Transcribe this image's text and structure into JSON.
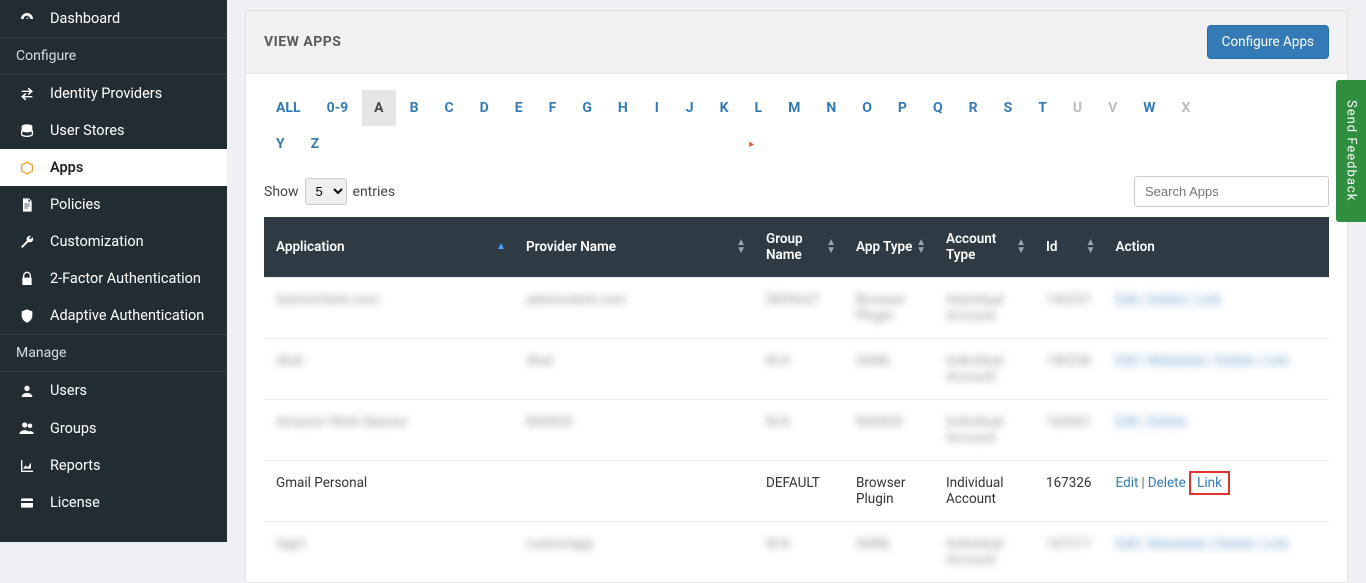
{
  "sidebar": {
    "items": [
      {
        "label": "Dashboard",
        "icon": "dashboard"
      },
      {
        "section": "Configure"
      },
      {
        "label": "Identity Providers",
        "icon": "swap"
      },
      {
        "label": "User Stores",
        "icon": "database"
      },
      {
        "label": "Apps",
        "icon": "cube",
        "active": true
      },
      {
        "label": "Policies",
        "icon": "document"
      },
      {
        "label": "Customization",
        "icon": "wrench"
      },
      {
        "label": "2-Factor Authentication",
        "icon": "lock"
      },
      {
        "label": "Adaptive Authentication",
        "icon": "shield"
      },
      {
        "section": "Manage"
      },
      {
        "label": "Users",
        "icon": "user"
      },
      {
        "label": "Groups",
        "icon": "users"
      },
      {
        "label": "Reports",
        "icon": "reports"
      },
      {
        "label": "License",
        "icon": "card"
      }
    ]
  },
  "panel": {
    "title": "VIEW APPS",
    "configure_btn": "Configure Apps"
  },
  "alpha": {
    "row1": [
      "ALL",
      "0-9",
      "A",
      "B",
      "C",
      "D",
      "E",
      "F",
      "G",
      "H",
      "I",
      "J",
      "K",
      "L",
      "M",
      "N",
      "O",
      "P",
      "Q",
      "R",
      "S",
      "T",
      "U",
      "V",
      "W",
      "X"
    ],
    "row2": [
      "Y",
      "Z"
    ],
    "active": "A",
    "disabled": [
      "U",
      "V",
      "X"
    ]
  },
  "controls": {
    "show": "Show",
    "entries": "entries",
    "page_size": "5",
    "search_placeholder": "Search Apps"
  },
  "columns": {
    "application": "Application",
    "provider": "Provider Name",
    "group": "Group Name",
    "apptype": "App Type",
    "accounttype": "Account Type",
    "id": "Id",
    "action": "Action"
  },
  "rows": [
    {
      "blur": true,
      "app": "AdminClient.com",
      "provider": "adminclient.com",
      "group": "DEFAULT",
      "apptype": "Browser Plugin",
      "accounttype": "Individual Account",
      "id": "142231",
      "actions": "Edit | Delete | Link"
    },
    {
      "blur": true,
      "app": "Ahal",
      "provider": "Ahal",
      "group": "N/A",
      "apptype": "SAML",
      "accounttype": "Individual Account",
      "id": "140236",
      "actions": "Edit | Metadata | Delete | Link"
    },
    {
      "blur": true,
      "app": "Amazon Work Spaces",
      "provider": "RADIUS",
      "group": "N/A",
      "apptype": "RADIUS",
      "accounttype": "Individual Account",
      "id": "162661",
      "actions": "Edit | Delete"
    },
    {
      "blur": false,
      "app": "Gmail Personal",
      "provider": "",
      "group": "DEFAULT",
      "apptype": "Browser Plugin",
      "accounttype": "Individual Account",
      "id": "167326",
      "edit": "Edit",
      "delete": "Delete",
      "link": "Link"
    },
    {
      "blur": true,
      "app": "App1",
      "provider": "customapp",
      "group": "N/A",
      "apptype": "SAML",
      "accounttype": "Individual Account",
      "id": "167217",
      "actions": "Edit | Metadata | Delete | Link"
    }
  ],
  "feedback": "Send Feedback"
}
